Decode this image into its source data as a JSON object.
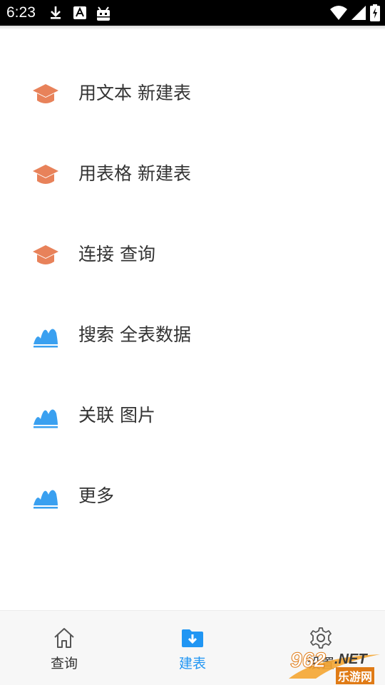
{
  "status_bar": {
    "time": "6:23"
  },
  "menu": {
    "items": [
      {
        "label": "用文本 新建表",
        "icon": "graduation-cap-icon"
      },
      {
        "label": "用表格 新建表",
        "icon": "graduation-cap-icon"
      },
      {
        "label": "连接 查询",
        "icon": "graduation-cap-icon"
      },
      {
        "label": "搜索 全表数据",
        "icon": "mountain-icon"
      },
      {
        "label": "关联 图片",
        "icon": "mountain-icon"
      },
      {
        "label": "更多",
        "icon": "mountain-icon"
      }
    ]
  },
  "bottom_nav": {
    "tabs": [
      {
        "label": "查询",
        "icon": "home-icon",
        "active": false
      },
      {
        "label": "建表",
        "icon": "folder-download-icon",
        "active": true
      },
      {
        "label": "设置",
        "icon": "gear-icon",
        "active": false
      }
    ]
  },
  "watermark": {
    "brand": "962",
    "suffix": ".NET",
    "sub": "乐游网"
  },
  "colors": {
    "orange_icon": "#E8825A",
    "blue_icon": "#3AA0F0",
    "accent": "#2196F3",
    "text": "#333333",
    "status_bar": "#000000",
    "nav_bg": "#F7F7F7"
  }
}
